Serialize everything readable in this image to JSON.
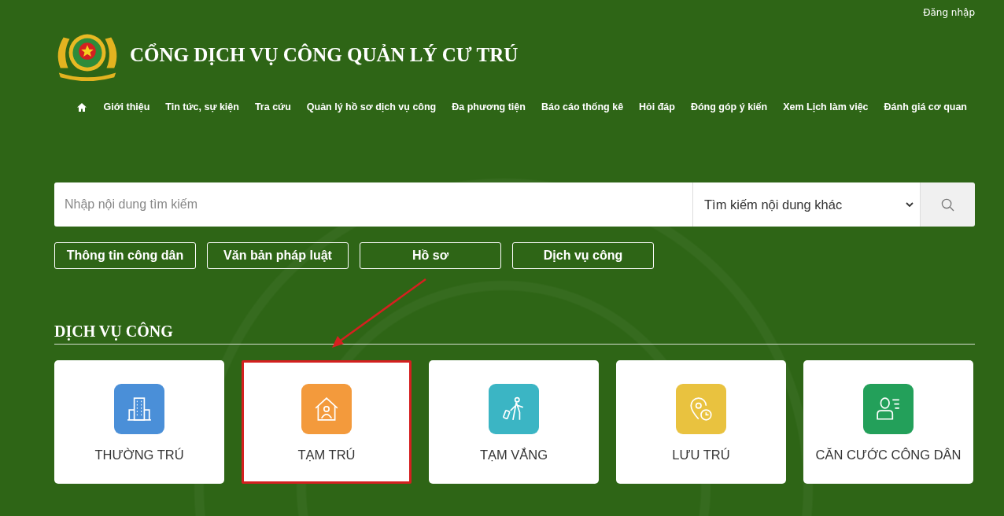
{
  "header": {
    "login": "Đăng nhập",
    "title": "CỔNG DỊCH VỤ CÔNG QUẢN LÝ CƯ TRÚ"
  },
  "nav": [
    "Giới thiệu",
    "Tin tức, sự kiện",
    "Tra cứu",
    "Quản lý hồ sơ dịch vụ công",
    "Đa phương tiện",
    "Báo cáo thống kê",
    "Hỏi đáp",
    "Đóng góp ý kiến",
    "Xem Lịch làm việc",
    "Đánh giá cơ quan"
  ],
  "search": {
    "placeholder": "Nhập nội dung tìm kiếm",
    "scope": "Tìm kiếm nội dung khác"
  },
  "filters": [
    "Thông tin công dân",
    "Văn bản pháp luật",
    "Hồ sơ",
    "Dịch vụ công"
  ],
  "section_title": "DỊCH VỤ CÔNG",
  "cards": [
    {
      "label": "THƯỜNG TRÚ",
      "kind": "building",
      "color": "#4a8fd8",
      "highlighted": false
    },
    {
      "label": "TẠM TRÚ",
      "kind": "house",
      "color": "#f39a3c",
      "highlighted": true
    },
    {
      "label": "TẠM VẮNG",
      "kind": "traveler",
      "color": "#3bb5c4",
      "highlighted": false
    },
    {
      "label": "LƯU TRÚ",
      "kind": "location",
      "color": "#e9c23f",
      "highlighted": false
    },
    {
      "label": "CĂN CƯỚC CÔNG DÂN",
      "kind": "idcard",
      "color": "#23a05a",
      "highlighted": false
    }
  ]
}
